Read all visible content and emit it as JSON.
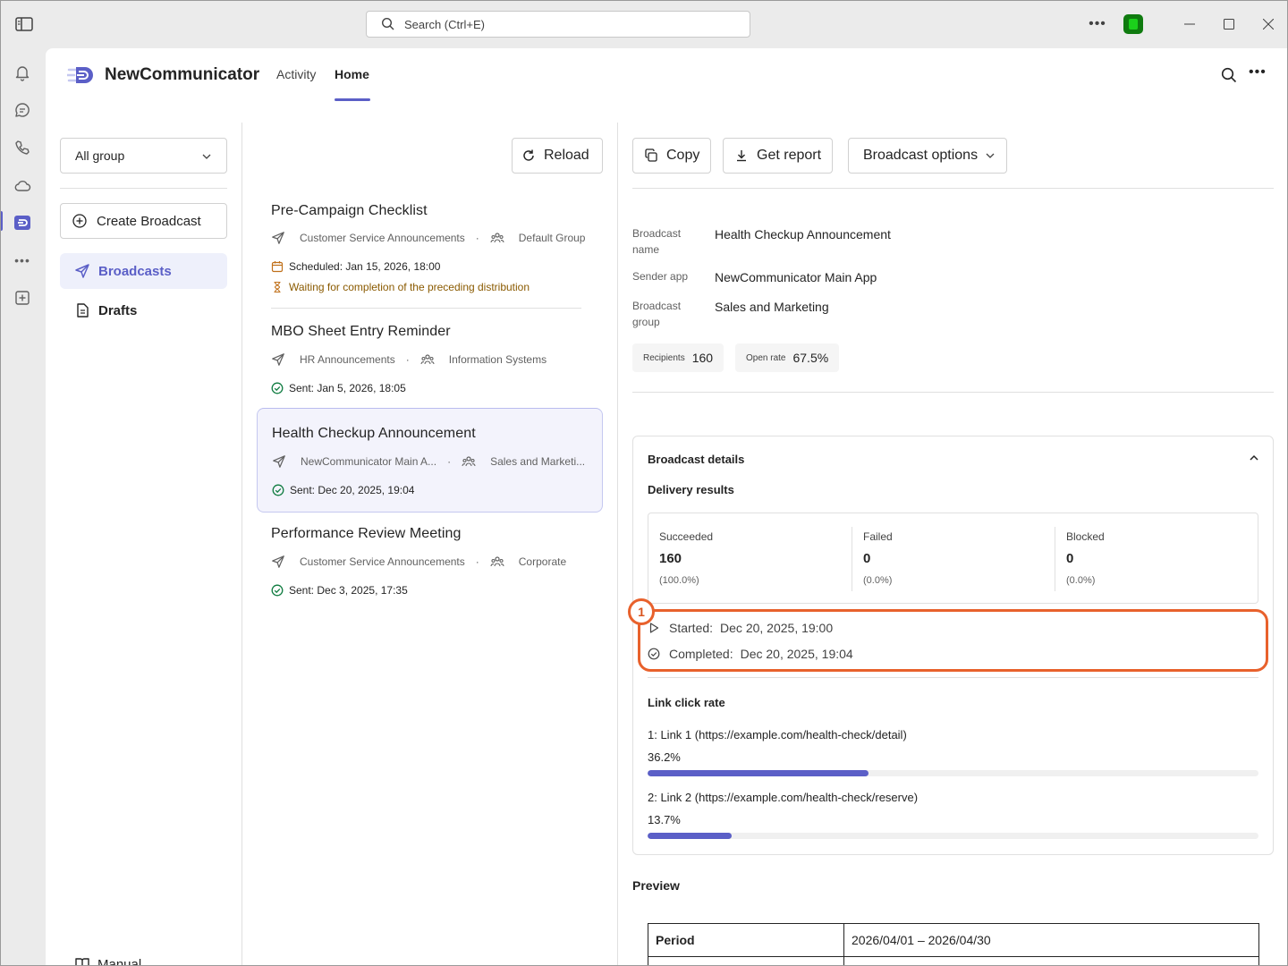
{
  "window": {
    "search_placeholder": "Search (Ctrl+E)",
    "more_label": "•••"
  },
  "rail": {
    "items": [
      "bell-icon",
      "chat-icon",
      "phone-icon",
      "cloud-icon",
      "app-icon",
      "more-icon",
      "add-app-icon"
    ],
    "more_label": "•••"
  },
  "app": {
    "name": "NewCommunicator",
    "tabs": [
      {
        "label": "Activity",
        "active": false
      },
      {
        "label": "Home",
        "active": true
      }
    ],
    "more_label": "•••"
  },
  "sidebar": {
    "group_select": "All group",
    "create_label": "Create Broadcast",
    "nav": [
      {
        "label": "Broadcasts",
        "active": true
      },
      {
        "label": "Drafts",
        "active": false
      }
    ],
    "manual_label": "Manual"
  },
  "list": {
    "reload_label": "Reload",
    "items": [
      {
        "title": "Pre-Campaign Checklist",
        "sender": "Customer Service Announcements",
        "group": "Default Group",
        "status": "Scheduled: Jan 15, 2026, 18:00",
        "note": "Waiting for completion of the preceding distribution"
      },
      {
        "title": "MBO Sheet Entry Reminder",
        "sender": "HR Announcements",
        "group": "Information Systems",
        "status": "Sent: Jan 5, 2026, 18:05"
      },
      {
        "title": "Health Checkup Announcement",
        "sender": "NewCommunicator Main A...",
        "group": "Sales and Marketi...",
        "status": "Sent: Dec 20, 2025, 19:04",
        "selected": true
      },
      {
        "title": "Performance Review Meeting",
        "sender": "Customer Service Announcements",
        "group": "Corporate",
        "status": "Sent: Dec 3, 2025, 17:35"
      }
    ]
  },
  "detail": {
    "actions": {
      "copy": "Copy",
      "report": "Get report",
      "options": "Broadcast options"
    },
    "fields": {
      "name_label_1": "Broadcast",
      "name_label_2": "name",
      "name_value": "Health Checkup Announcement",
      "sender_label": "Sender app",
      "sender_value": "NewCommunicator Main App",
      "group_label_1": "Broadcast",
      "group_label_2": "group",
      "group_value": "Sales and Marketing"
    },
    "stats": {
      "recipients_label": "Recipients",
      "recipients_value": "160",
      "open_rate_label": "Open rate",
      "open_rate_value": "67.5%"
    },
    "details_card": {
      "title": "Broadcast details",
      "delivery_title": "Delivery results",
      "results": [
        {
          "label": "Succeeded",
          "value": "160",
          "pct": "(100.0%)"
        },
        {
          "label": "Failed",
          "value": "0",
          "pct": "(0.0%)"
        },
        {
          "label": "Blocked",
          "value": "0",
          "pct": "(0.0%)"
        }
      ],
      "started_label": "Started:",
      "started_value": "Dec 20, 2025, 19:00",
      "completed_label": "Completed:",
      "completed_value": "Dec 20, 2025, 19:04",
      "link_title": "Link click rate",
      "links": [
        {
          "prefix": "1: Link 1",
          "url": "(https://example.com/health-check/detail)",
          "pct_label": "36.2%",
          "rate": 0.362
        },
        {
          "prefix": "2: Link 2",
          "url": "(https://example.com/health-check/reserve)",
          "pct_label": "13.7%",
          "rate": 0.137
        }
      ]
    },
    "annotation_number": "1",
    "preview_title": "Preview",
    "preview_table": [
      {
        "key": "Period",
        "value": "2026/04/01 – 2026/04/30"
      },
      {
        "key": "",
        "value": ""
      }
    ]
  }
}
